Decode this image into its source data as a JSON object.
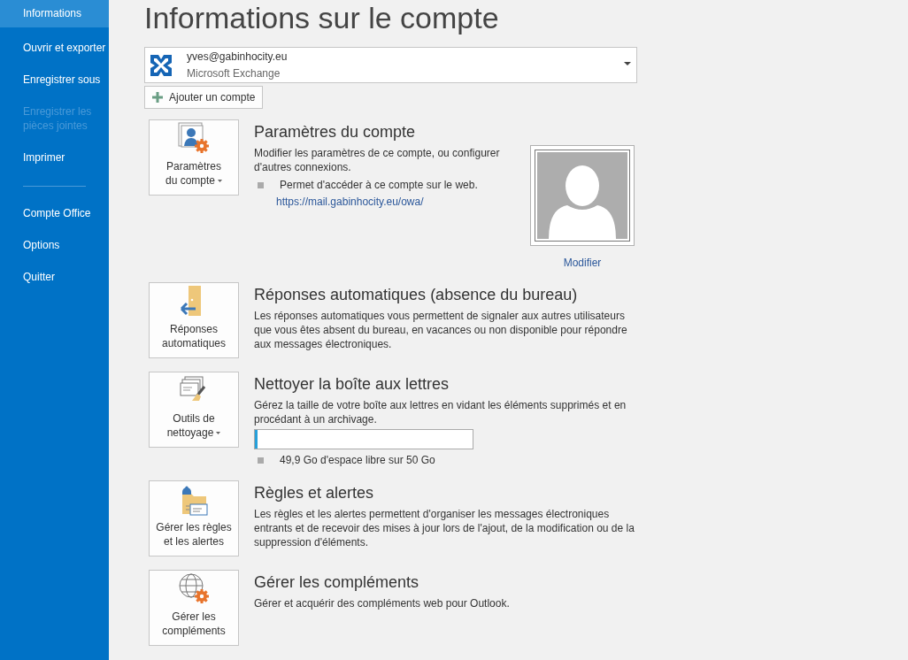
{
  "sidebar": {
    "groups": [
      {
        "items": [
          {
            "label": "Informations",
            "selected": true,
            "disabled": false
          },
          {
            "label": "Ouvrir et exporter",
            "selected": false,
            "disabled": false
          },
          {
            "label": "Enregistrer sous",
            "selected": false,
            "disabled": false
          },
          {
            "label": "Enregistrer les pièces jointes",
            "selected": false,
            "disabled": true
          },
          {
            "label": "Imprimer",
            "selected": false,
            "disabled": false
          }
        ]
      },
      {
        "items": [
          {
            "label": "Compte Office",
            "selected": false,
            "disabled": false
          },
          {
            "label": "Options",
            "selected": false,
            "disabled": false
          },
          {
            "label": "Quitter",
            "selected": false,
            "disabled": false
          }
        ]
      }
    ]
  },
  "title": "Informations sur le compte",
  "account": {
    "email": "yves@gabinhocity.eu",
    "type": "Microsoft Exchange"
  },
  "add_account_button": "Ajouter un compte",
  "sections": [
    {
      "button_label": [
        "Paramètres",
        "du compte"
      ],
      "has_menu": true,
      "heading": "Paramètres du compte",
      "description": "Modifier les paramètres de ce compte, ou configurer d'autres connexions.",
      "bullets": [
        "Permet d'accéder à ce compte sur le web."
      ],
      "link": "https://mail.gabinhocity.eu/owa/",
      "photo_link": "Modifier"
    },
    {
      "button_label": [
        "Réponses",
        "automatiques"
      ],
      "has_menu": false,
      "heading": "Réponses automatiques (absence du bureau)",
      "description": "Les réponses automatiques vous permettent de signaler aux autres utilisateurs que vous êtes absent du bureau, en vacances ou non disponible pour répondre aux messages électroniques."
    },
    {
      "button_label": [
        "Outils de",
        "nettoyage"
      ],
      "has_menu": true,
      "heading": "Nettoyer la boîte aux lettres",
      "description": "Gérez la taille de votre boîte aux lettres en vidant les éléments supprimés et en procédant à un archivage.",
      "level": 0.012,
      "bullets": [
        "49,9 Go d'espace libre sur 50 Go"
      ]
    },
    {
      "button_label": [
        "Gérer les règles",
        "et les alertes"
      ],
      "has_menu": false,
      "heading": "Règles et alertes",
      "description": "Les règles et les alertes permettent d'organiser les messages électroniques entrants et de recevoir des mises à jour lors de l'ajout, de la modification ou de la suppression d'éléments."
    },
    {
      "button_label": [
        "Gérer les",
        "compléments"
      ],
      "has_menu": false,
      "heading": "Gérer les compléments",
      "description": "Gérer et acquérir des compléments web pour Outlook."
    }
  ]
}
